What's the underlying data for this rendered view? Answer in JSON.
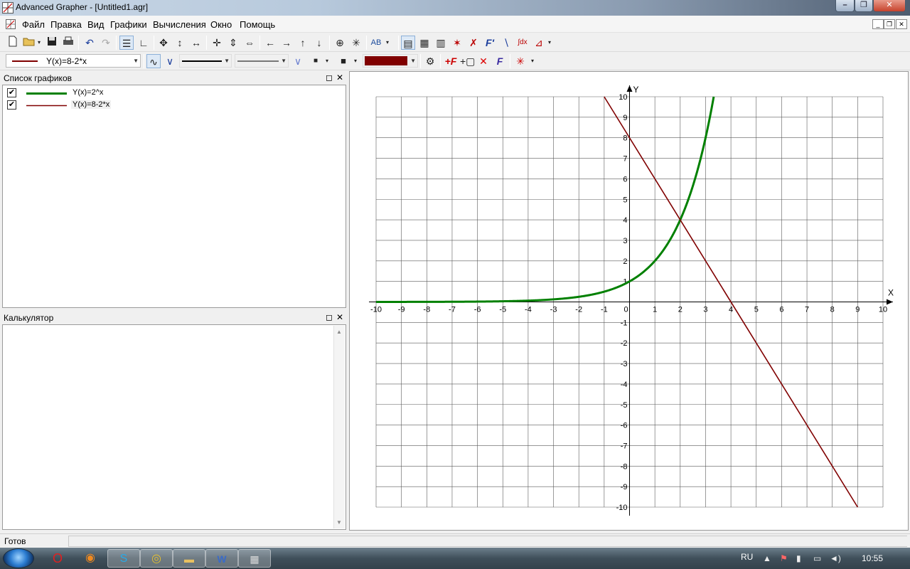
{
  "window": {
    "title": "Advanced Grapher - [Untitled1.agr]",
    "buttons": {
      "minimize": "–",
      "maximize": "❐",
      "close": "✕"
    }
  },
  "menu": {
    "items": [
      "Файл",
      "Правка",
      "Вид",
      "Графики",
      "Вычисления",
      "Окно",
      "Помощь"
    ]
  },
  "toolbar2": {
    "graph_select_value": "Y(x)=8-2*x",
    "selected_color": "#800000"
  },
  "graph_list_panel": {
    "title": "Список графиков",
    "items": [
      {
        "label": "Y(x)=2^x",
        "checked": true,
        "color": "#008000"
      },
      {
        "label": "Y(x)=8-2*x",
        "checked": true,
        "color": "#800000"
      }
    ]
  },
  "calculator_panel": {
    "title": "Калькулятор"
  },
  "graph": {
    "x_axis_label": "X",
    "y_axis_label": "Y",
    "xlim": [
      -10,
      10
    ],
    "ylim": [
      -10,
      10
    ],
    "x_ticks": [
      "-10",
      "-9",
      "-8",
      "-7",
      "-6",
      "-5",
      "-4",
      "-3",
      "-2",
      "-1",
      "0",
      "1",
      "2",
      "3",
      "4",
      "5",
      "6",
      "7",
      "8",
      "9",
      "10"
    ],
    "y_ticks": [
      "10",
      "9",
      "8",
      "7",
      "6",
      "5",
      "4",
      "3",
      "2",
      "1",
      "-1",
      "-2",
      "-3",
      "-4",
      "-5",
      "-6",
      "-7",
      "-8",
      "-9",
      "-10"
    ],
    "grid": true
  },
  "chart_data": {
    "type": "line",
    "title": "",
    "xlabel": "X",
    "ylabel": "Y",
    "xlim": [
      -10,
      10
    ],
    "ylim": [
      -10,
      10
    ],
    "grid": true,
    "series": [
      {
        "name": "Y(x)=2^x",
        "color": "#008000",
        "x": [
          -10,
          -8,
          -6,
          -5,
          -4,
          -3,
          -2,
          -1,
          0,
          1,
          2,
          2.5,
          3,
          3.32
        ],
        "y": [
          0.001,
          0.004,
          0.016,
          0.031,
          0.063,
          0.125,
          0.25,
          0.5,
          1,
          2,
          4,
          5.66,
          8,
          10
        ]
      },
      {
        "name": "Y(x)=8-2*x",
        "color": "#800000",
        "x": [
          -1,
          9
        ],
        "y": [
          10,
          -10
        ]
      }
    ]
  },
  "status": {
    "text": "Готов"
  },
  "taskbar": {
    "language": "RU",
    "clock": "10:55"
  }
}
